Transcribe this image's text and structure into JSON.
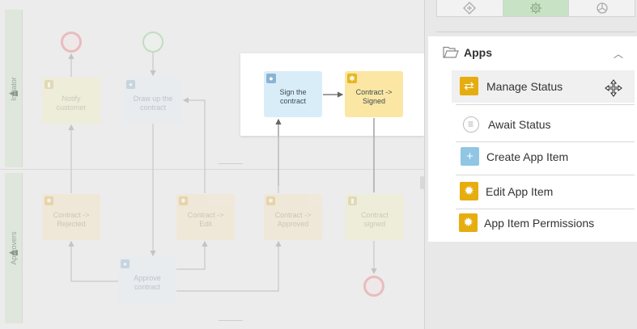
{
  "canvas": {
    "lanes": [
      {
        "label": "Initiator"
      },
      {
        "label": "Approvers"
      }
    ],
    "tasks": {
      "notify_customer": {
        "label": "Notify customer",
        "kind": "notification"
      },
      "draw_up_contract": {
        "label": "Draw up the contract",
        "kind": "user"
      },
      "contract_rejected": {
        "label": "Contract -> Rejected",
        "kind": "automatic"
      },
      "contract_edit": {
        "label": "Contract -> Edit",
        "kind": "automatic"
      },
      "contract_approved": {
        "label": "Contract -> Approved",
        "kind": "automatic"
      },
      "contract_signed_notify": {
        "label": "Contract signed",
        "kind": "notification"
      },
      "approve_contract": {
        "label": "Approve contract",
        "kind": "user"
      }
    },
    "focus": {
      "sign_contract": {
        "label": "Sign the contract",
        "kind": "user"
      },
      "contract_signed": {
        "label": "Contract -> Signed",
        "kind": "automatic"
      }
    }
  },
  "panel": {
    "tabs": [
      {
        "name": "diamond-gateway-icon",
        "active": false
      },
      {
        "name": "gear-icon",
        "active": true
      },
      {
        "name": "chart-icon",
        "active": false
      }
    ],
    "group": {
      "title": "Apps",
      "expanded": true,
      "items": [
        {
          "label": "Manage Status",
          "icon": "swap-arrows-icon",
          "hovered": true
        },
        {
          "label": "Await Status",
          "icon": "clock-icon"
        },
        {
          "label": "Create App Item",
          "icon": "plus-icon"
        },
        {
          "label": "Edit App Item",
          "icon": "gear-icon"
        },
        {
          "label": "App Item Permissions",
          "icon": "gear-icon"
        }
      ]
    }
  },
  "colors": {
    "accent_gold": "#e6ad10",
    "accent_blue": "#90c6e4",
    "active_tab": "#c8e2c6",
    "end_event": "#e58d92",
    "start_event": "#a6d3a5"
  }
}
